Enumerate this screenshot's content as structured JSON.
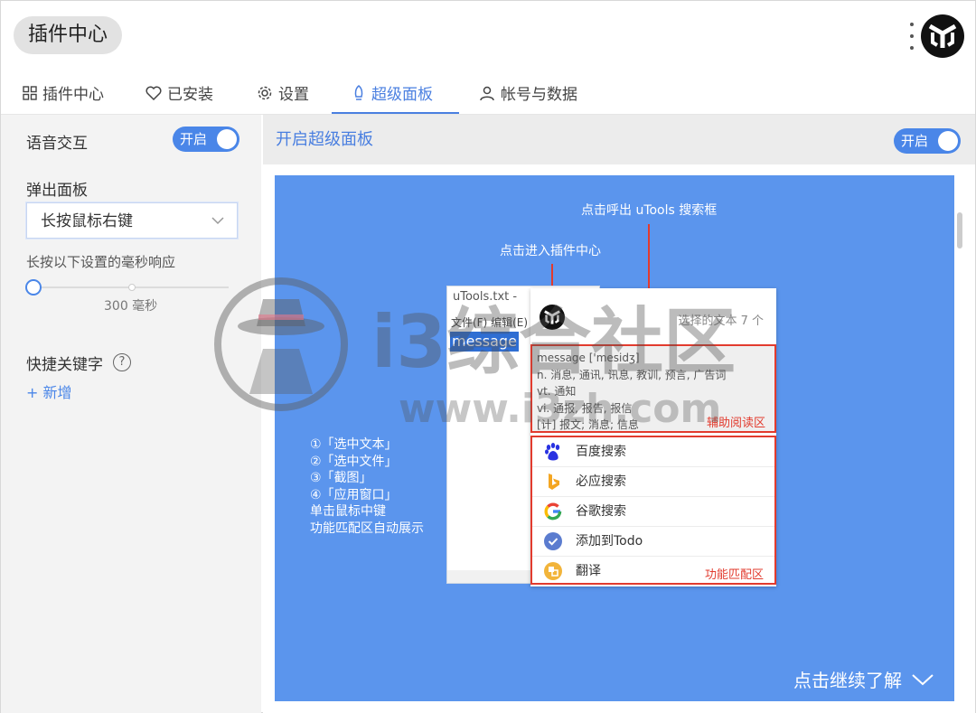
{
  "header": {
    "title": "插件中心"
  },
  "tabs": [
    {
      "label": "插件中心",
      "icon": "grid-icon"
    },
    {
      "label": "已安装",
      "icon": "heart-icon"
    },
    {
      "label": "设置",
      "icon": "gear-icon"
    },
    {
      "label": "超级面板",
      "icon": "rocket-icon",
      "active": true
    },
    {
      "label": "帐号与数据",
      "icon": "user-icon"
    }
  ],
  "sidebar": {
    "voice_label": "语音交互",
    "voice_toggle": "开启",
    "popup_label": "弹出面板",
    "popup_select": "长按鼠标右键",
    "hold_hint": "长按以下设置的毫秒响应",
    "slider_value": "300 毫秒",
    "shortcut_label": "快捷关键字",
    "help": "?",
    "add_new": "+ 新增"
  },
  "content": {
    "title": "开启超级面板",
    "toggle": "开启",
    "banner": {
      "ann_search": "点击呼出 uTools 搜索框",
      "ann_plugin": "点击进入插件中心",
      "steps": [
        "①「选中文本」",
        "②「选中文件」",
        "③「截图」",
        "④「应用窗口」",
        "单击鼠标中键",
        "功能匹配区自动展示"
      ],
      "more": "点击继续了解",
      "notepad": {
        "title": "uTools.txt -",
        "menu": "文件(F)  编辑(E)",
        "selected": "message"
      },
      "panel": {
        "count": "选择的文本 7 个",
        "reading_lines": [
          "message ['mesidʒ]",
          "n. 消息, 通讯, 讯息, 教训, 预言, 广告词",
          "vt. 通知",
          "vi. 通报, 报告, 报信",
          "[计] 报文; 消息; 信息"
        ],
        "reading_label": "辅助阅读区",
        "func_label": "功能匹配区",
        "functions": [
          {
            "name": "百度搜索",
            "icon": "baidu-icon"
          },
          {
            "name": "必应搜索",
            "icon": "bing-icon"
          },
          {
            "name": "谷歌搜索",
            "icon": "google-icon"
          },
          {
            "name": "添加到Todo",
            "icon": "check-circle-icon"
          },
          {
            "name": "翻译",
            "icon": "translate-icon"
          }
        ]
      }
    }
  },
  "watermark": {
    "text": "i3综合社区",
    "url": "www.i3zh.com"
  },
  "colors": {
    "accent": "#4a86e8",
    "banner": "#5b95ed",
    "highlight": "#e23b2e"
  }
}
